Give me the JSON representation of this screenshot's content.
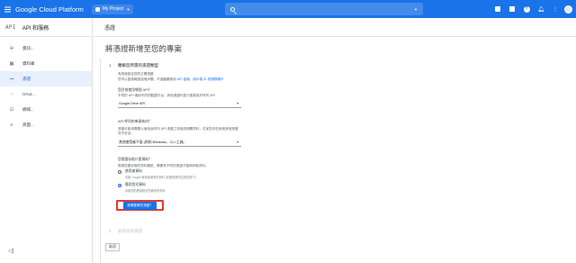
{
  "topbar": {
    "brand": "Google Cloud Platform",
    "project": "My Project",
    "icons": [
      "menu-icon",
      "search-icon",
      "apps-icon",
      "cloud-shell-icon",
      "help-icon",
      "notifications-icon",
      "more-icon",
      "avatar"
    ]
  },
  "sidebar": {
    "api_badge": "API",
    "title": "API 和服務",
    "items": [
      {
        "label": "資訊...",
        "icon": "dashboard-icon"
      },
      {
        "label": "資料庫",
        "icon": "library-icon"
      },
      {
        "label": "憑證",
        "icon": "key-icon"
      },
      {
        "label": "OAut...",
        "icon": "oauth-icon"
      },
      {
        "label": "網域...",
        "icon": "domain-icon"
      },
      {
        "label": "頁面...",
        "icon": "page-usage-icon"
      }
    ],
    "collapse": "◁|"
  },
  "breadcrumb": "憑證",
  "page_title": "將憑證新增至您的專案",
  "step1": {
    "num": "1",
    "title": "瞭解您所需的憑證類型",
    "intro_line1": "為快速設定您的正確憑證",
    "intro_line2_a": "您可以直接略過這個步驟，不過繼續使用",
    "intro_line2_link1": "API 金鑰",
    "intro_line2_sep": "、",
    "intro_line2_link2": "用戶端 ID 或服務帳戶",
    "q1_label": "您目前使用哪個 API？",
    "q1_sub": "不同的 API 適用不同的驗證平台，其他憑證可能只是將用於呼叫 API",
    "q1_value": "Google Drive API",
    "q2_label": "API 呼叫的來源為何？",
    "q2_sub_line1": "憑證可能用需要以使用此呼叫 API 憑證之存取該相關資料，在某些存在使用其他憑證",
    "q2_sub_line2": "些不安全。",
    "q2_value": "其他使用者介面 (例如 Windows、CLI 工具)",
    "q3_label": "您需要存取什麼資料？",
    "q3_sub": "根據您要存取的資料類型，需要有不同的憑證才能夠存取資料。",
    "radio1_title": "使用者資料",
    "radio1_sub": "存取 Google 使用者擁有的資料 (在獲得其同意的前提下)",
    "radio2_title": "應用程式資料",
    "radio2_sub": "存取您的應用程式所擁有的資料",
    "next_button": "我需要哪些憑證？"
  },
  "step2": {
    "num": "2",
    "title": "取得您的憑證"
  },
  "cancel_button": "取消"
}
